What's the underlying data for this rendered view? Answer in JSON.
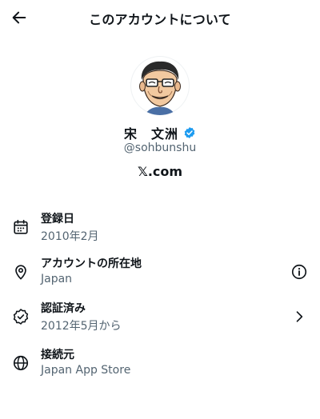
{
  "header": {
    "title": "このアカウントについて",
    "back_icon": "back-arrow-icon"
  },
  "profile": {
    "display_name": "宋　文洲",
    "handle": "@sohbunshu",
    "service": "𝕏.com",
    "verified_color": "#1d9bf0"
  },
  "info": [
    {
      "icon": "calendar-icon",
      "label": "登録日",
      "value": "2010年2月",
      "action": null
    },
    {
      "icon": "location-pin-icon",
      "label": "アカウントの所在地",
      "value": "Japan",
      "action": "info-icon"
    },
    {
      "icon": "verified-badge-outline-icon",
      "label": "認証済み",
      "value": "2012年5月から",
      "action": "chevron-right-icon"
    },
    {
      "icon": "globe-icon",
      "label": "接続元",
      "value": "Japan App Store",
      "action": null
    }
  ],
  "colors": {
    "text": "#0f1419",
    "secondary": "#536471",
    "accent": "#1d9bf0"
  }
}
